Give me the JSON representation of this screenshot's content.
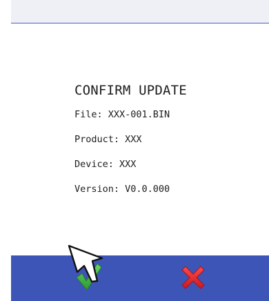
{
  "dialog": {
    "title": "CONFIRM UPDATE",
    "file_line": "File: XXX-001.BIN",
    "product_line": "Product: XXX",
    "device_line": "Device: XXX",
    "version_line": "Version: V0.0.000"
  },
  "actions": {
    "confirm_icon": "green-check-icon",
    "cancel_icon": "red-x-icon"
  },
  "colors": {
    "header_bg": "#eef0f5",
    "header_line": "#4b5ec6",
    "footer_bg": "#3e55b8",
    "confirm": "#3daa3f",
    "cancel": "#e3262b",
    "text": "#1c1c1c"
  },
  "cursor": {
    "icon": "arrow-pointer-icon"
  }
}
